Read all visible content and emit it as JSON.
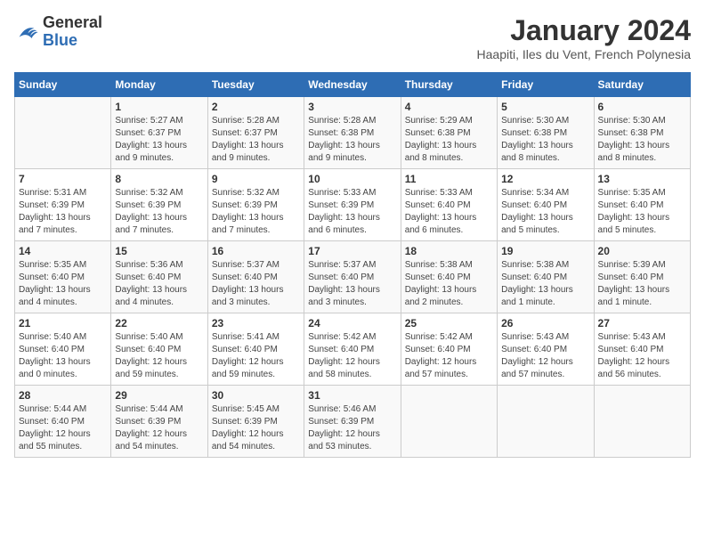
{
  "header": {
    "logo_general": "General",
    "logo_blue": "Blue",
    "month_title": "January 2024",
    "location": "Haapiti, Iles du Vent, French Polynesia"
  },
  "days_of_week": [
    "Sunday",
    "Monday",
    "Tuesday",
    "Wednesday",
    "Thursday",
    "Friday",
    "Saturday"
  ],
  "weeks": [
    [
      {
        "day": "",
        "sunrise": "",
        "sunset": "",
        "daylight": ""
      },
      {
        "day": "1",
        "sunrise": "Sunrise: 5:27 AM",
        "sunset": "Sunset: 6:37 PM",
        "daylight": "Daylight: 13 hours and 9 minutes."
      },
      {
        "day": "2",
        "sunrise": "Sunrise: 5:28 AM",
        "sunset": "Sunset: 6:37 PM",
        "daylight": "Daylight: 13 hours and 9 minutes."
      },
      {
        "day": "3",
        "sunrise": "Sunrise: 5:28 AM",
        "sunset": "Sunset: 6:38 PM",
        "daylight": "Daylight: 13 hours and 9 minutes."
      },
      {
        "day": "4",
        "sunrise": "Sunrise: 5:29 AM",
        "sunset": "Sunset: 6:38 PM",
        "daylight": "Daylight: 13 hours and 8 minutes."
      },
      {
        "day": "5",
        "sunrise": "Sunrise: 5:30 AM",
        "sunset": "Sunset: 6:38 PM",
        "daylight": "Daylight: 13 hours and 8 minutes."
      },
      {
        "day": "6",
        "sunrise": "Sunrise: 5:30 AM",
        "sunset": "Sunset: 6:38 PM",
        "daylight": "Daylight: 13 hours and 8 minutes."
      }
    ],
    [
      {
        "day": "7",
        "sunrise": "Sunrise: 5:31 AM",
        "sunset": "Sunset: 6:39 PM",
        "daylight": "Daylight: 13 hours and 7 minutes."
      },
      {
        "day": "8",
        "sunrise": "Sunrise: 5:32 AM",
        "sunset": "Sunset: 6:39 PM",
        "daylight": "Daylight: 13 hours and 7 minutes."
      },
      {
        "day": "9",
        "sunrise": "Sunrise: 5:32 AM",
        "sunset": "Sunset: 6:39 PM",
        "daylight": "Daylight: 13 hours and 7 minutes."
      },
      {
        "day": "10",
        "sunrise": "Sunrise: 5:33 AM",
        "sunset": "Sunset: 6:39 PM",
        "daylight": "Daylight: 13 hours and 6 minutes."
      },
      {
        "day": "11",
        "sunrise": "Sunrise: 5:33 AM",
        "sunset": "Sunset: 6:40 PM",
        "daylight": "Daylight: 13 hours and 6 minutes."
      },
      {
        "day": "12",
        "sunrise": "Sunrise: 5:34 AM",
        "sunset": "Sunset: 6:40 PM",
        "daylight": "Daylight: 13 hours and 5 minutes."
      },
      {
        "day": "13",
        "sunrise": "Sunrise: 5:35 AM",
        "sunset": "Sunset: 6:40 PM",
        "daylight": "Daylight: 13 hours and 5 minutes."
      }
    ],
    [
      {
        "day": "14",
        "sunrise": "Sunrise: 5:35 AM",
        "sunset": "Sunset: 6:40 PM",
        "daylight": "Daylight: 13 hours and 4 minutes."
      },
      {
        "day": "15",
        "sunrise": "Sunrise: 5:36 AM",
        "sunset": "Sunset: 6:40 PM",
        "daylight": "Daylight: 13 hours and 4 minutes."
      },
      {
        "day": "16",
        "sunrise": "Sunrise: 5:37 AM",
        "sunset": "Sunset: 6:40 PM",
        "daylight": "Daylight: 13 hours and 3 minutes."
      },
      {
        "day": "17",
        "sunrise": "Sunrise: 5:37 AM",
        "sunset": "Sunset: 6:40 PM",
        "daylight": "Daylight: 13 hours and 3 minutes."
      },
      {
        "day": "18",
        "sunrise": "Sunrise: 5:38 AM",
        "sunset": "Sunset: 6:40 PM",
        "daylight": "Daylight: 13 hours and 2 minutes."
      },
      {
        "day": "19",
        "sunrise": "Sunrise: 5:38 AM",
        "sunset": "Sunset: 6:40 PM",
        "daylight": "Daylight: 13 hours and 1 minute."
      },
      {
        "day": "20",
        "sunrise": "Sunrise: 5:39 AM",
        "sunset": "Sunset: 6:40 PM",
        "daylight": "Daylight: 13 hours and 1 minute."
      }
    ],
    [
      {
        "day": "21",
        "sunrise": "Sunrise: 5:40 AM",
        "sunset": "Sunset: 6:40 PM",
        "daylight": "Daylight: 13 hours and 0 minutes."
      },
      {
        "day": "22",
        "sunrise": "Sunrise: 5:40 AM",
        "sunset": "Sunset: 6:40 PM",
        "daylight": "Daylight: 12 hours and 59 minutes."
      },
      {
        "day": "23",
        "sunrise": "Sunrise: 5:41 AM",
        "sunset": "Sunset: 6:40 PM",
        "daylight": "Daylight: 12 hours and 59 minutes."
      },
      {
        "day": "24",
        "sunrise": "Sunrise: 5:42 AM",
        "sunset": "Sunset: 6:40 PM",
        "daylight": "Daylight: 12 hours and 58 minutes."
      },
      {
        "day": "25",
        "sunrise": "Sunrise: 5:42 AM",
        "sunset": "Sunset: 6:40 PM",
        "daylight": "Daylight: 12 hours and 57 minutes."
      },
      {
        "day": "26",
        "sunrise": "Sunrise: 5:43 AM",
        "sunset": "Sunset: 6:40 PM",
        "daylight": "Daylight: 12 hours and 57 minutes."
      },
      {
        "day": "27",
        "sunrise": "Sunrise: 5:43 AM",
        "sunset": "Sunset: 6:40 PM",
        "daylight": "Daylight: 12 hours and 56 minutes."
      }
    ],
    [
      {
        "day": "28",
        "sunrise": "Sunrise: 5:44 AM",
        "sunset": "Sunset: 6:40 PM",
        "daylight": "Daylight: 12 hours and 55 minutes."
      },
      {
        "day": "29",
        "sunrise": "Sunrise: 5:44 AM",
        "sunset": "Sunset: 6:39 PM",
        "daylight": "Daylight: 12 hours and 54 minutes."
      },
      {
        "day": "30",
        "sunrise": "Sunrise: 5:45 AM",
        "sunset": "Sunset: 6:39 PM",
        "daylight": "Daylight: 12 hours and 54 minutes."
      },
      {
        "day": "31",
        "sunrise": "Sunrise: 5:46 AM",
        "sunset": "Sunset: 6:39 PM",
        "daylight": "Daylight: 12 hours and 53 minutes."
      },
      {
        "day": "",
        "sunrise": "",
        "sunset": "",
        "daylight": ""
      },
      {
        "day": "",
        "sunrise": "",
        "sunset": "",
        "daylight": ""
      },
      {
        "day": "",
        "sunrise": "",
        "sunset": "",
        "daylight": ""
      }
    ]
  ]
}
